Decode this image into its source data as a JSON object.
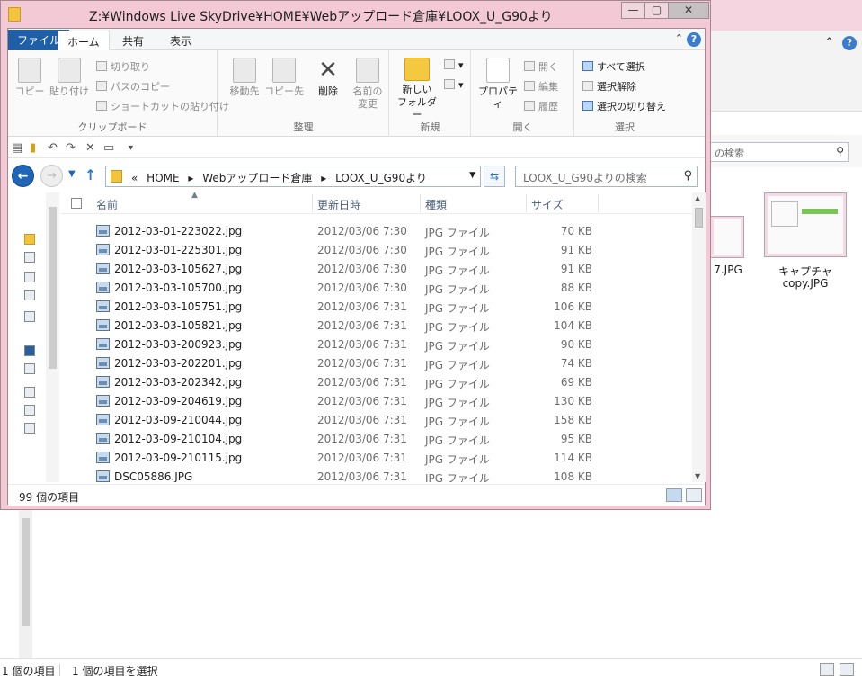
{
  "window": {
    "title": "Z:¥Windows Live SkyDrive¥HOME¥Webアップロード倉庫¥LOOX_U_G90より",
    "controls": {
      "minimize": "—",
      "maximize": "▢",
      "close": "✕"
    }
  },
  "ribbon_tabs": [
    {
      "label": "ファイル"
    },
    {
      "label": "ホーム"
    },
    {
      "label": "共有"
    },
    {
      "label": "表示"
    }
  ],
  "ribbon": {
    "clipboard": {
      "copy": "コピー",
      "paste": "貼り付け",
      "cut": "切り取り",
      "copy_path": "パスのコピー",
      "paste_shortcut": "ショートカットの貼り付け",
      "group": "クリップボード"
    },
    "organize": {
      "move_to": "移動先",
      "copy_to": "コピー先",
      "delete": "削除",
      "rename_1": "名前の",
      "rename_2": "変更",
      "group": "整理"
    },
    "new": {
      "new_folder_1": "新しい",
      "new_folder_2": "フォルダー",
      "group": "新規"
    },
    "open": {
      "properties": "プロパティ",
      "open": "開く",
      "edit": "編集",
      "history": "履歴",
      "group": "開く"
    },
    "select": {
      "select_all": "すべて選択",
      "select_none": "選択解除",
      "invert": "選択の切り替え",
      "group": "選択"
    }
  },
  "address": {
    "crumbs": [
      "«",
      "HOME",
      "▸",
      "Webアップロード倉庫",
      "▸",
      "LOOX_U_G90より"
    ],
    "search_placeholder": "LOOX_U_G90よりの検索"
  },
  "columns": {
    "name": "名前",
    "date": "更新日時",
    "type": "種類",
    "size": "サイズ"
  },
  "files": [
    {
      "name": "2012-03-01-223022.jpg",
      "date": "2012/03/06 7:30",
      "type": "JPG ファイル",
      "size": "70 KB"
    },
    {
      "name": "2012-03-01-225301.jpg",
      "date": "2012/03/06 7:30",
      "type": "JPG ファイル",
      "size": "91 KB"
    },
    {
      "name": "2012-03-03-105627.jpg",
      "date": "2012/03/06 7:30",
      "type": "JPG ファイル",
      "size": "91 KB"
    },
    {
      "name": "2012-03-03-105700.jpg",
      "date": "2012/03/06 7:30",
      "type": "JPG ファイル",
      "size": "88 KB"
    },
    {
      "name": "2012-03-03-105751.jpg",
      "date": "2012/03/06 7:31",
      "type": "JPG ファイル",
      "size": "106 KB"
    },
    {
      "name": "2012-03-03-105821.jpg",
      "date": "2012/03/06 7:31",
      "type": "JPG ファイル",
      "size": "104 KB"
    },
    {
      "name": "2012-03-03-200923.jpg",
      "date": "2012/03/06 7:31",
      "type": "JPG ファイル",
      "size": "90 KB"
    },
    {
      "name": "2012-03-03-202201.jpg",
      "date": "2012/03/06 7:31",
      "type": "JPG ファイル",
      "size": "74 KB"
    },
    {
      "name": "2012-03-03-202342.jpg",
      "date": "2012/03/06 7:31",
      "type": "JPG ファイル",
      "size": "69 KB"
    },
    {
      "name": "2012-03-09-204619.jpg",
      "date": "2012/03/06 7:31",
      "type": "JPG ファイル",
      "size": "130 KB"
    },
    {
      "name": "2012-03-09-210044.jpg",
      "date": "2012/03/06 7:31",
      "type": "JPG ファイル",
      "size": "158 KB"
    },
    {
      "name": "2012-03-09-210104.jpg",
      "date": "2012/03/06 7:31",
      "type": "JPG ファイル",
      "size": "95 KB"
    },
    {
      "name": "2012-03-09-210115.jpg",
      "date": "2012/03/06 7:31",
      "type": "JPG ファイル",
      "size": "114 KB"
    },
    {
      "name": "DSC05886.JPG",
      "date": "2012/03/06 7:31",
      "type": "JPG ファイル",
      "size": "108 KB"
    }
  ],
  "status": {
    "item_count": "99 個の項目"
  },
  "background_window": {
    "search_placeholder": "の検索",
    "thumbs": [
      {
        "caption": "7.JPG"
      },
      {
        "caption_1": "キャプチャ",
        "caption_2": "copy.JPG"
      }
    ],
    "status_count": "1 個の項目",
    "status_selected": "1 個の項目を選択"
  },
  "colors": {
    "title_bar": "#f4c9d6",
    "file_tab": "#1f5fa8",
    "accent": "#1f66b8"
  }
}
